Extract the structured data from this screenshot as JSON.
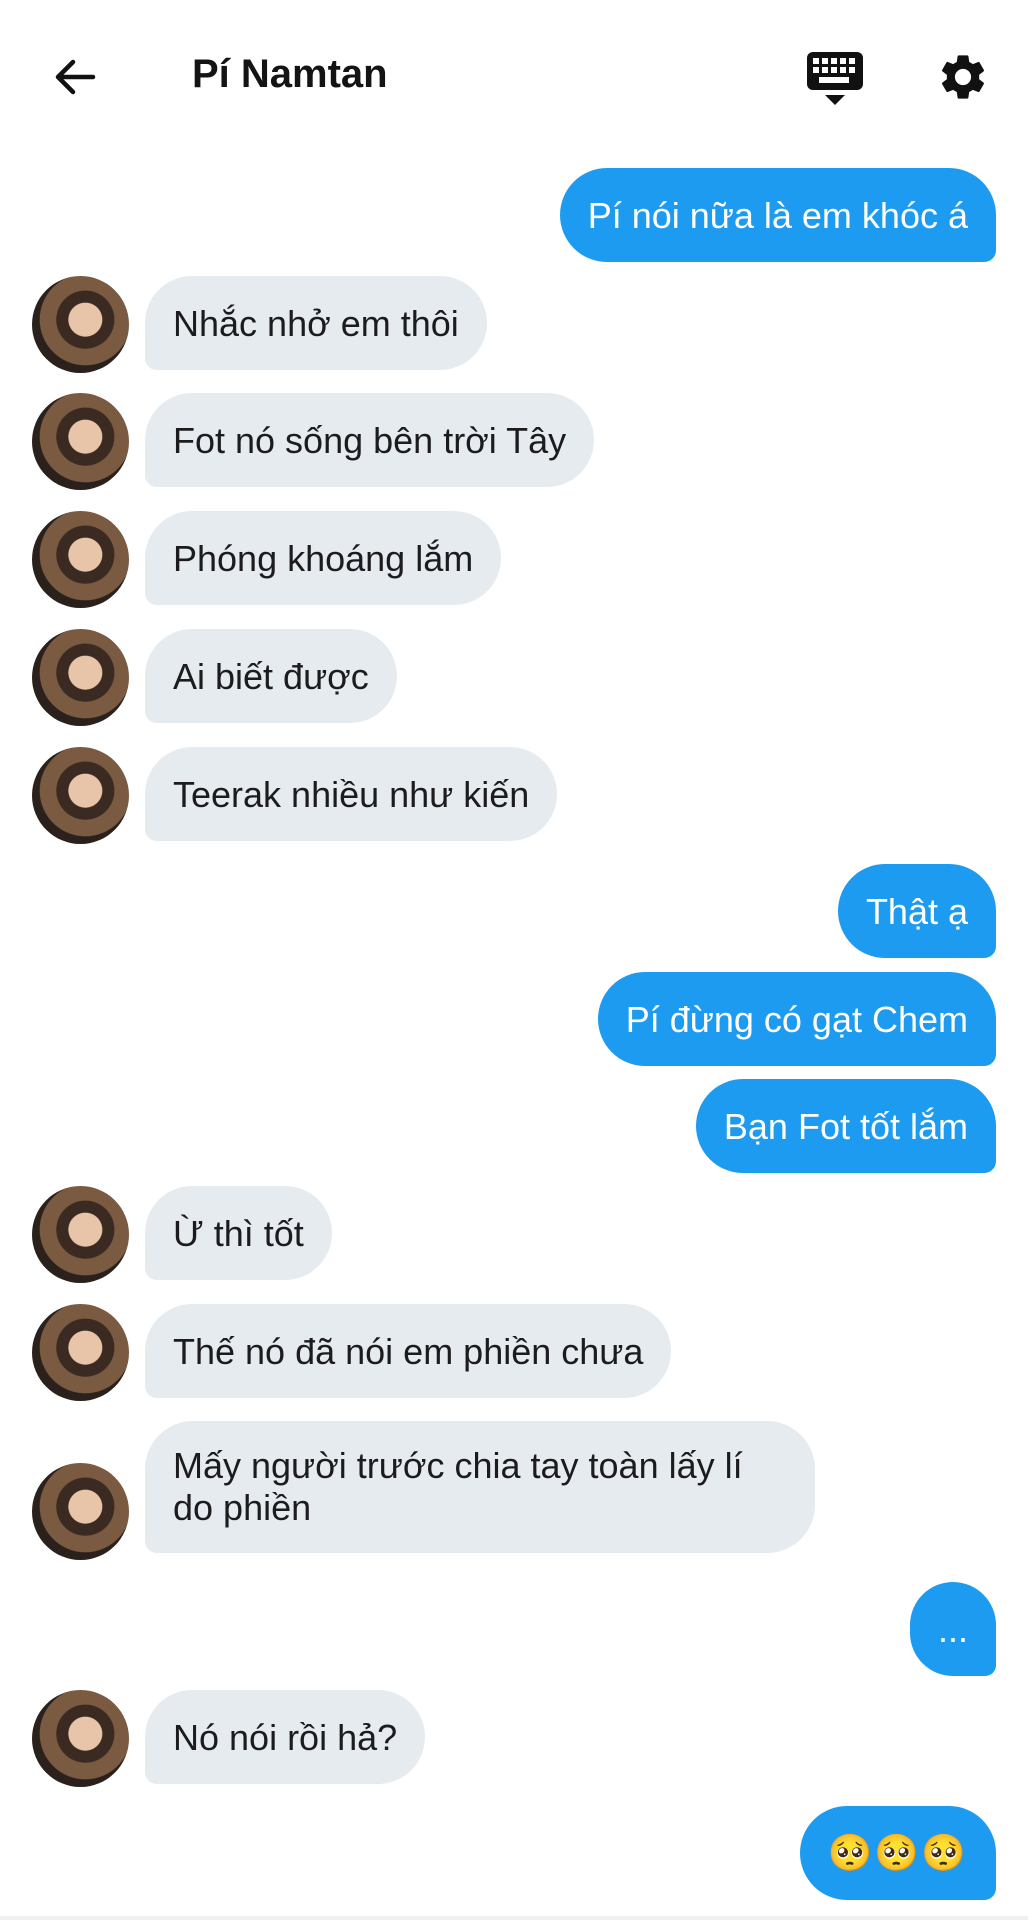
{
  "header": {
    "title": "Pí Namtan",
    "back_icon": "arrow-left-icon",
    "keyboard_icon": "keyboard-icon",
    "settings_icon": "gear-icon"
  },
  "colors": {
    "outgoing_bubble": "#1d9bf0",
    "incoming_bubble": "#e6ebf0",
    "background": "#ffffff"
  },
  "messages": [
    {
      "direction": "out",
      "text": "Pí nói nữa là em khóc á"
    },
    {
      "direction": "in",
      "text": "Nhắc nhở em thôi"
    },
    {
      "direction": "in",
      "text": "Fot nó sống bên trời Tây"
    },
    {
      "direction": "in",
      "text": "Phóng khoáng lắm"
    },
    {
      "direction": "in",
      "text": "Ai biết được"
    },
    {
      "direction": "in",
      "text": "Teerak nhiều như kiến"
    },
    {
      "direction": "out",
      "text": "Thật ạ"
    },
    {
      "direction": "out",
      "text": "Pí đừng có gạt Chem"
    },
    {
      "direction": "out",
      "text": "Bạn Fot tốt lắm"
    },
    {
      "direction": "in",
      "text": "Ừ thì tốt"
    },
    {
      "direction": "in",
      "text": "Thế nó đã nói em phiền chưa"
    },
    {
      "direction": "in",
      "text": "Mấy người trước chia tay toàn lấy lí do phiền"
    },
    {
      "direction": "out",
      "text": "..."
    },
    {
      "direction": "in",
      "text": "Nó nói rồi hả?"
    },
    {
      "direction": "out",
      "text": "🥺🥺🥺"
    }
  ]
}
